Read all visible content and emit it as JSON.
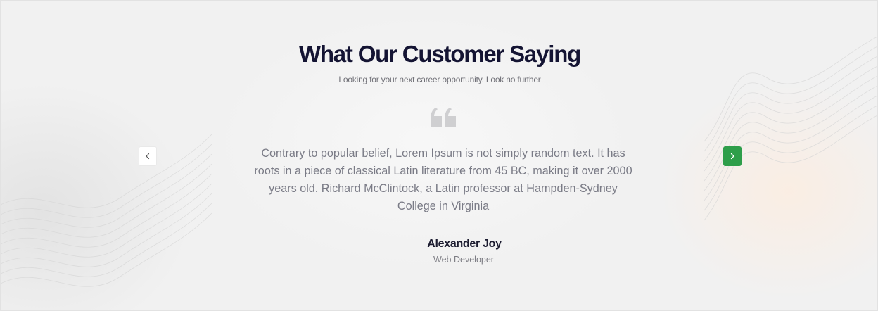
{
  "section": {
    "title": "What Our Customer Saying",
    "subtitle": "Looking for your next career opportunity. Look no further"
  },
  "testimonial": {
    "quote_icon": "quote-icon",
    "text": "Contrary to popular belief, Lorem Ipsum is not simply random text. It has roots in a piece of classical Latin literature from 45 BC, making it over 2000 years old. Richard McClintock, a Latin professor at Hampden-Sydney College in Virginia",
    "author_name": "Alexander Joy",
    "author_role": "Web Developer"
  },
  "navigation": {
    "prev_icon": "chevron-left-icon",
    "next_icon": "chevron-right-icon"
  },
  "colors": {
    "heading": "#141433",
    "body_text": "#7a7b86",
    "accent_green": "#2e9e4a",
    "background": "#f1f1f1"
  }
}
